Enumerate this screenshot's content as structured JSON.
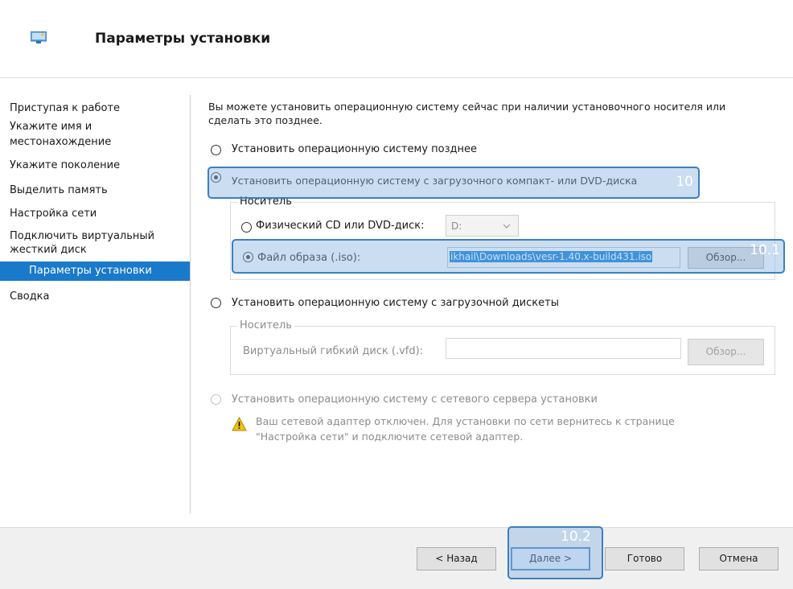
{
  "header": {
    "title": "Параметры установки",
    "icon": "wizard-monitor-icon"
  },
  "sidebar": {
    "items": [
      {
        "label": "Приступая к работе"
      },
      {
        "label": "Укажите имя и"
      },
      {
        "label": "местонахождение"
      },
      {
        "label": "Укажите поколение"
      },
      {
        "label": "Выделить память"
      },
      {
        "label": "Настройка сети"
      },
      {
        "label": "Подключить виртуальный"
      },
      {
        "label": "жесткий диск"
      },
      {
        "label": "Параметры установки",
        "active": true
      },
      {
        "label": "Сводка"
      }
    ]
  },
  "content": {
    "intro_line1": "Вы можете установить операционную систему сейчас при наличии установочного носителя или",
    "intro_line2": "сделать это позднее.",
    "opt_later": "Установить операционную систему позднее",
    "opt_dvd": "Установить операционную систему с загрузочного компакт- или DVD-диска",
    "media_legend": "Носитель",
    "physical_label": "Физический CD или DVD-диск:",
    "drive_value": "D:",
    "iso_label": "Файл образа (.iso):",
    "iso_value": "ikhail\\Downloads\\vesr-1.40.x-build431.iso",
    "browse_label": "Обзор...",
    "opt_floppy": "Установить операционную систему с загрузочной дискеты",
    "floppy_legend": "Носитель",
    "vfd_label": "Виртуальный гибкий диск (.vfd):",
    "vfd_value": "",
    "browse2_label": "Обзор...",
    "opt_network": "Установить операционную систему с сетевого сервера установки",
    "warning_line1": "Ваш сетевой адаптер отключен. Для установки по сети вернитесь к странице",
    "warning_line2": "\"Настройка сети\" и подключите сетевой адаптер.",
    "warning_icon": "warning-icon"
  },
  "annotations": {
    "a1": "10",
    "a2": "10.1",
    "a3": "10.2"
  },
  "footer": {
    "back": "< Назад",
    "next": "Далее >",
    "finish": "Готово",
    "cancel": "Отмена"
  },
  "colors": {
    "accent": "#1979ca",
    "highlight": "#3c7fc1"
  }
}
